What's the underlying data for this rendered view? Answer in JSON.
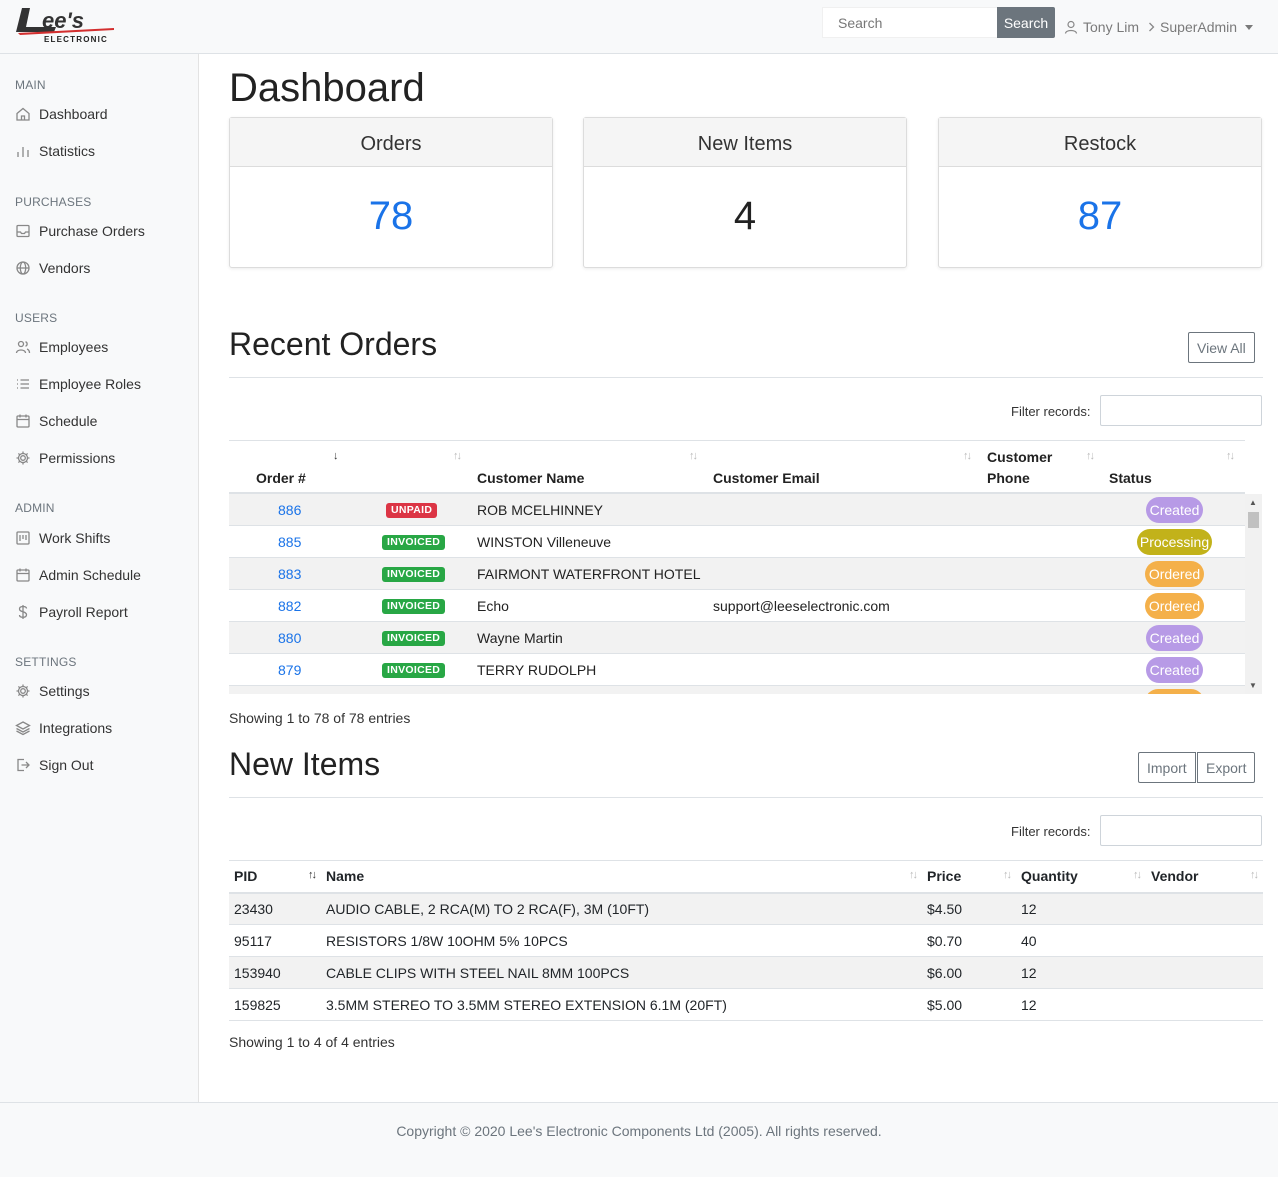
{
  "brand": {
    "logo_text": "ELECTRONIC"
  },
  "topbar": {
    "search_placeholder": "Search",
    "search_button": "Search",
    "user_name": "Tony Lim",
    "user_role": "SuperAdmin"
  },
  "sidebar": {
    "main_heading": "MAIN",
    "dashboard": "Dashboard",
    "statistics": "Statistics",
    "purchases_heading": "PURCHASES",
    "purchase_orders": "Purchase Orders",
    "vendors": "Vendors",
    "users_heading": "USERS",
    "employees": "Employees",
    "employee_roles": "Employee Roles",
    "schedule": "Schedule",
    "permissions": "Permissions",
    "admin_heading": "ADMIN",
    "work_shifts": "Work Shifts",
    "admin_schedule": "Admin Schedule",
    "payroll_report": "Payroll Report",
    "settings_heading": "SETTINGS",
    "settings": "Settings",
    "integrations": "Integrations",
    "sign_out": "Sign Out"
  },
  "page": {
    "title": "Dashboard"
  },
  "cards": {
    "orders": {
      "label": "Orders",
      "value": "78",
      "color": "#1a73e8"
    },
    "new_items": {
      "label": "New Items",
      "value": "4",
      "color": "#222222"
    },
    "restock": {
      "label": "Restock",
      "value": "87",
      "color": "#1a73e8"
    }
  },
  "recent_orders": {
    "title": "Recent Orders",
    "view_all": "View All",
    "filter_label": "Filter records:",
    "columns": {
      "order": "Order #",
      "customer_name": "Customer Name",
      "customer_email": "Customer Email",
      "customer_phone_1": "Customer",
      "customer_phone_2": "Phone",
      "status": "Status"
    },
    "rows": [
      {
        "order": "886",
        "billing": "UNPAID",
        "billing_color": "#dc3545",
        "name": "ROB MCELHINNEY",
        "email": "",
        "phone": "",
        "status": "Created",
        "status_color": "#b79ae6"
      },
      {
        "order": "885",
        "billing": "INVOICED",
        "billing_color": "#28a745",
        "name": "WINSTON Villeneuve",
        "email": "",
        "phone": "",
        "status": "Processing",
        "status_color": "#c2b21a"
      },
      {
        "order": "883",
        "billing": "INVOICED",
        "billing_color": "#28a745",
        "name": "FAIRMONT WATERFRONT HOTEL",
        "email": "",
        "phone": "",
        "status": "Ordered",
        "status_color": "#f4b04a"
      },
      {
        "order": "882",
        "billing": "INVOICED",
        "billing_color": "#28a745",
        "name": "Echo",
        "email": "support@leeselectronic.com",
        "phone": "",
        "status": "Ordered",
        "status_color": "#f4b04a"
      },
      {
        "order": "880",
        "billing": "INVOICED",
        "billing_color": "#28a745",
        "name": "Wayne Martin",
        "email": "",
        "phone": "",
        "status": "Created",
        "status_color": "#b79ae6"
      },
      {
        "order": "879",
        "billing": "INVOICED",
        "billing_color": "#28a745",
        "name": "TERRY RUDOLPH",
        "email": "",
        "phone": "",
        "status": "Created",
        "status_color": "#b79ae6"
      }
    ],
    "showing": "Showing 1 to 78 of 78 entries"
  },
  "new_items": {
    "title": "New Items",
    "import": "Import",
    "export": "Export",
    "filter_label": "Filter records:",
    "columns": {
      "pid": "PID",
      "name": "Name",
      "price": "Price",
      "quantity": "Quantity",
      "vendor": "Vendor"
    },
    "rows": [
      {
        "pid": "23430",
        "name": "AUDIO CABLE, 2 RCA(M) TO 2 RCA(F), 3M (10FT)",
        "price": "$4.50",
        "quantity": "12",
        "vendor": ""
      },
      {
        "pid": "95117",
        "name": "RESISTORS 1/8W 10OHM 5% 10PCS",
        "price": "$0.70",
        "quantity": "40",
        "vendor": ""
      },
      {
        "pid": "153940",
        "name": "CABLE CLIPS WITH STEEL NAIL 8MM 100PCS",
        "price": "$6.00",
        "quantity": "12",
        "vendor": ""
      },
      {
        "pid": "159825",
        "name": "3.5MM STEREO TO 3.5MM STEREO EXTENSION 6.1M (20FT)",
        "price": "$5.00",
        "quantity": "12",
        "vendor": ""
      }
    ],
    "showing": "Showing 1 to 4 of 4 entries"
  },
  "footer": {
    "copyright": "Copyright © 2020 Lee's Electronic Components Ltd (2005). All rights reserved."
  }
}
